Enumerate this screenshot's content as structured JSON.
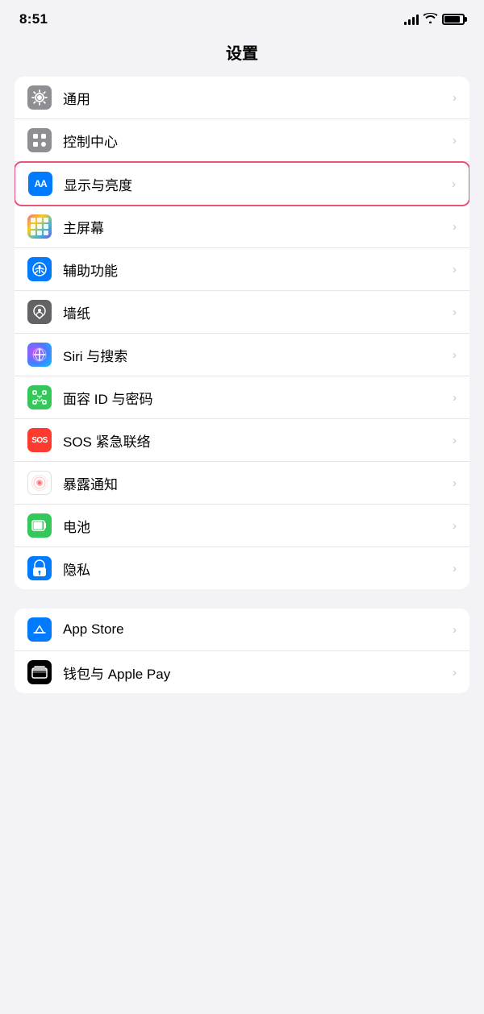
{
  "statusBar": {
    "time": "8:51",
    "signalBars": [
      5,
      8,
      11,
      14
    ],
    "battery": 85
  },
  "pageTitle": "设置",
  "sections": [
    {
      "id": "general-section",
      "rows": [
        {
          "id": "general",
          "label": "通用",
          "iconType": "gear",
          "iconBg": "gray",
          "highlighted": false
        },
        {
          "id": "control-center",
          "label": "控制中心",
          "iconType": "control",
          "iconBg": "gray",
          "highlighted": false
        },
        {
          "id": "display",
          "label": "显示与亮度",
          "iconType": "aa",
          "iconBg": "blue",
          "highlighted": true
        },
        {
          "id": "homescreen",
          "label": "主屏幕",
          "iconType": "grid",
          "iconBg": "multicolor",
          "highlighted": false
        },
        {
          "id": "accessibility",
          "label": "辅助功能",
          "iconType": "accessibility",
          "iconBg": "blue-circle",
          "highlighted": false
        },
        {
          "id": "wallpaper",
          "label": "墙纸",
          "iconType": "flower",
          "iconBg": "silver",
          "highlighted": false
        },
        {
          "id": "siri",
          "label": "Siri 与搜索",
          "iconType": "siri",
          "iconBg": "siri",
          "highlighted": false
        },
        {
          "id": "faceid",
          "label": "面容 ID 与密码",
          "iconType": "face",
          "iconBg": "green",
          "highlighted": false
        },
        {
          "id": "sos",
          "label": "SOS 紧急联络",
          "iconType": "sos",
          "iconBg": "red",
          "highlighted": false
        },
        {
          "id": "exposure",
          "label": "暴露通知",
          "iconType": "exposure",
          "iconBg": "exposure",
          "highlighted": false
        },
        {
          "id": "battery",
          "label": "电池",
          "iconType": "battery",
          "iconBg": "battery",
          "highlighted": false
        },
        {
          "id": "privacy",
          "label": "隐私",
          "iconType": "hand",
          "iconBg": "privacy",
          "highlighted": false
        }
      ]
    },
    {
      "id": "store-section",
      "rows": [
        {
          "id": "appstore",
          "label": "App Store",
          "iconType": "appstore",
          "iconBg": "appstore",
          "highlighted": false
        },
        {
          "id": "wallet",
          "label": "钱包与 Apple Pay",
          "iconType": "wallet",
          "iconBg": "wallet",
          "highlighted": false
        }
      ]
    }
  ]
}
